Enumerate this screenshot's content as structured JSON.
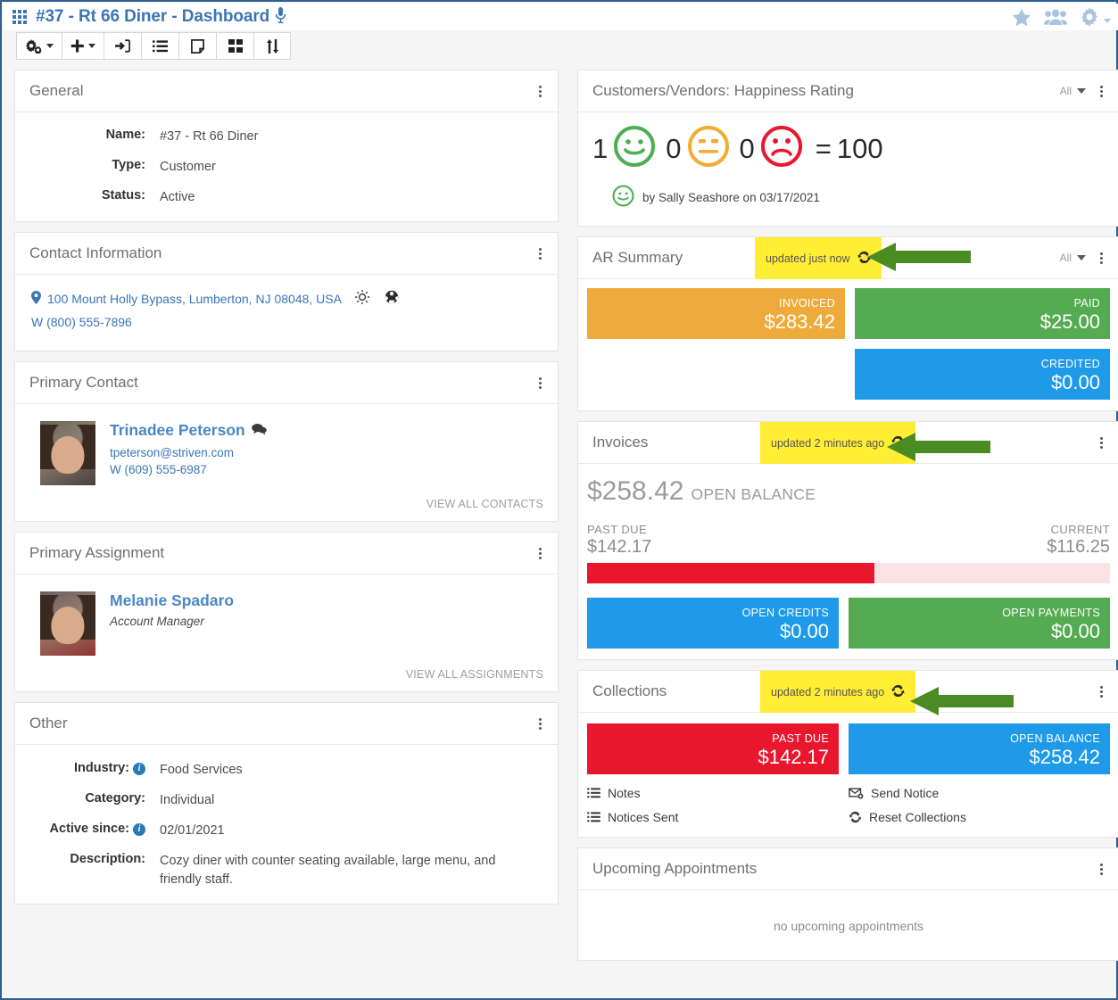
{
  "header": {
    "title": "#37 - Rt 66 Diner - Dashboard",
    "grid_icon": "app-grid-icon",
    "mic_icon": "microphone-icon",
    "right_icons": [
      "star-icon",
      "people-icon",
      "gear-icon"
    ]
  },
  "toolbar": {
    "buttons": [
      {
        "name": "settings-cogs-button",
        "icon": "cogs-icon",
        "caret": true
      },
      {
        "name": "add-button",
        "icon": "plus-icon",
        "caret": true
      },
      {
        "name": "sign-in-button",
        "icon": "sign-in-icon",
        "caret": false
      },
      {
        "name": "list-view-button",
        "icon": "list-icon",
        "caret": false
      },
      {
        "name": "note-button",
        "icon": "note-icon",
        "caret": false
      },
      {
        "name": "grid-view-button",
        "icon": "grid-icon",
        "caret": false
      },
      {
        "name": "sort-button",
        "icon": "sort-icon",
        "caret": false
      }
    ]
  },
  "general": {
    "title": "General",
    "fields": [
      {
        "label": "Name:",
        "value": "#37 - Rt 66 Diner"
      },
      {
        "label": "Type:",
        "value": "Customer"
      },
      {
        "label": "Status:",
        "value": "Active"
      }
    ]
  },
  "contact_information": {
    "title": "Contact Information",
    "address": "100 Mount Holly Bypass, Lumberton, NJ 08048, USA",
    "address_icons": [
      "map-pin-icon",
      "weather-sun-icon",
      "globe-icon"
    ],
    "phone": "W (800) 555-7896"
  },
  "primary_contact": {
    "title": "Primary Contact",
    "name": "Trinadee Peterson",
    "email": "tpeterson@striven.com",
    "phone": "W (609) 555-6987",
    "view_all": "VIEW ALL CONTACTS",
    "chat_icon": "chat-bubbles-icon",
    "avatar": "contact-avatar"
  },
  "primary_assignment": {
    "title": "Primary Assignment",
    "name": "Melanie Spadaro",
    "role": "Account Manager",
    "view_all": "VIEW ALL ASSIGNMENTS",
    "avatar": "assignment-avatar"
  },
  "other": {
    "title": "Other",
    "fields": [
      {
        "label": "Industry:",
        "value": "Food Services",
        "info": true
      },
      {
        "label": "Category:",
        "value": "Individual",
        "info": false
      },
      {
        "label": "Active since:",
        "value": "02/01/2021",
        "info": true
      },
      {
        "label": "Description:",
        "value": "Cozy diner with counter seating available, large menu, and friendly staff.",
        "info": false
      }
    ]
  },
  "happiness": {
    "title": "Customers/Vendors: Happiness Rating",
    "filter_label": "All",
    "happy_count": "1",
    "neutral_count": "0",
    "sad_count": "0",
    "equals": "=",
    "score": "100",
    "byline": "by Sally Seashore on 03/17/2021",
    "colors": {
      "happy": "#4caf50",
      "neutral": "#f0ad31",
      "sad": "#e8172e"
    }
  },
  "ar_summary": {
    "title": "AR Summary",
    "updated": "updated just now",
    "filter_label": "All",
    "tiles": [
      {
        "label": "INVOICED",
        "value": "$283.42",
        "color": "#eeab3c",
        "width_pct": 49
      },
      {
        "label": "PAID",
        "value": "$25.00",
        "color": "#54ab52",
        "width_pct": 49
      },
      {
        "label": "CREDITED",
        "value": "$0.00",
        "color": "#1e9ae8",
        "width_pct": 49
      }
    ]
  },
  "invoices": {
    "title": "Invoices",
    "updated": "updated 2 minutes ago",
    "open_balance_amount": "$258.42",
    "open_balance_caption": "OPEN BALANCE",
    "past_due_label": "PAST DUE",
    "past_due_value": "$142.17",
    "current_label": "CURRENT",
    "current_value": "$116.25",
    "past_due_pct": 55,
    "bar_fill_color": "#e8172e",
    "bar_track_color": "#fbe2e2",
    "tiles": [
      {
        "label": "OPEN CREDITS",
        "value": "$0.00",
        "color": "#1e9ae8"
      },
      {
        "label": "OPEN PAYMENTS",
        "value": "$0.00",
        "color": "#54ab52"
      }
    ]
  },
  "collections": {
    "title": "Collections",
    "updated": "updated 2 minutes ago",
    "tiles": [
      {
        "label": "PAST DUE",
        "value": "$142.17",
        "color": "#e8172e"
      },
      {
        "label": "OPEN BALANCE",
        "value": "$258.42",
        "color": "#1e9ae8"
      }
    ],
    "links": [
      {
        "label": "Notes",
        "icon": "list-icon"
      },
      {
        "label": "Notices Sent",
        "icon": "list-icon"
      },
      {
        "label": "Send Notice",
        "icon": "send-envelope-icon"
      },
      {
        "label": "Reset Collections",
        "icon": "refresh-icon"
      }
    ]
  },
  "upcoming_appointments": {
    "title": "Upcoming Appointments",
    "empty_text": "no upcoming appointments"
  },
  "annotations": {
    "arrow_color": "#4b8b23",
    "highlight_color": "#ffee33"
  }
}
